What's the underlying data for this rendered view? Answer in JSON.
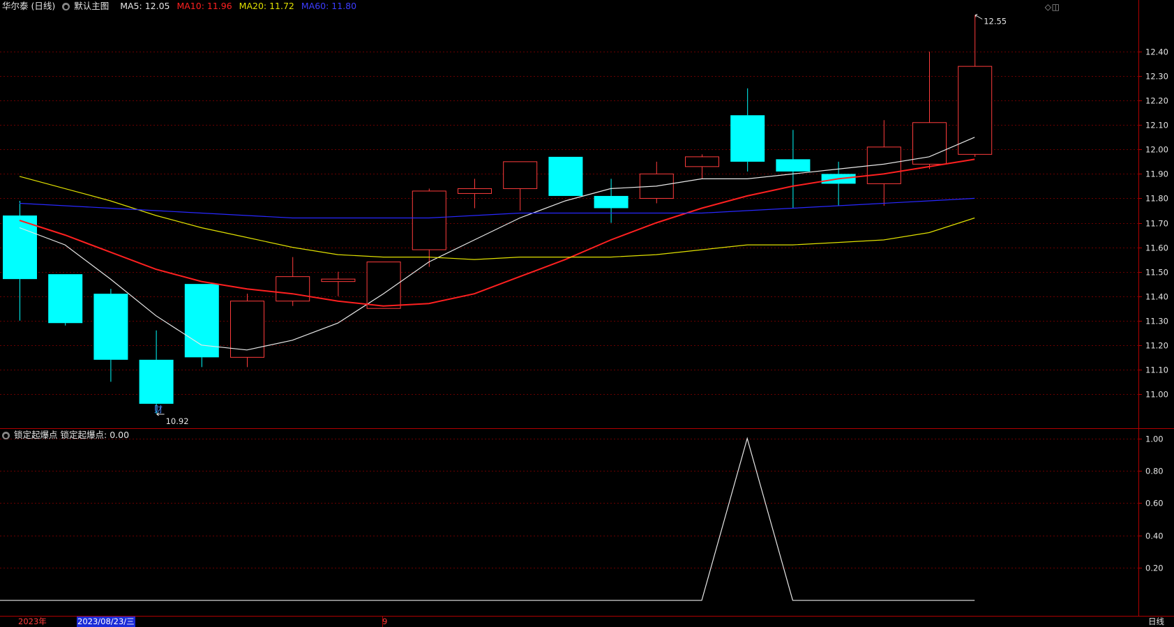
{
  "header": {
    "stock": "华尔泰 (日线)",
    "template": "默认主图",
    "ma5": "MA5: 12.05",
    "ma10": "MA10: 11.96",
    "ma20": "MA20: 11.72",
    "ma60": "MA60: 11.80"
  },
  "indicator": {
    "name": "锁定起爆点",
    "value": "锁定起爆点: 0.00"
  },
  "colors": {
    "up": "#ff3c3c",
    "down": "#00ffff",
    "ma5": "#e8e8e8",
    "ma10": "#ff2020",
    "ma20": "#e0e000",
    "ma60": "#2828ff",
    "axis": "#b00000"
  },
  "annotations": {
    "high": "12.55",
    "low": "10.92",
    "finance_marker": "财"
  },
  "footer": {
    "year": "2023年",
    "date": "2023/08/23/三",
    "month": "9",
    "period": "日线"
  },
  "chart_data": [
    {
      "type": "candlestick",
      "y_ticks": [
        "11.00",
        "11.10",
        "11.20",
        "11.30",
        "11.40",
        "11.50",
        "11.60",
        "11.70",
        "11.80",
        "11.90",
        "12.00",
        "12.10",
        "12.20",
        "12.30",
        "12.40"
      ],
      "ylim": [
        10.86,
        12.56
      ],
      "candles": [
        {
          "o": 11.73,
          "h": 11.79,
          "l": 11.3,
          "c": 11.47
        },
        {
          "o": 11.49,
          "h": 11.49,
          "l": 11.28,
          "c": 11.29
        },
        {
          "o": 11.41,
          "h": 11.43,
          "l": 11.05,
          "c": 11.14
        },
        {
          "o": 11.14,
          "h": 11.26,
          "l": 10.92,
          "c": 10.96
        },
        {
          "o": 11.45,
          "h": 11.45,
          "l": 11.11,
          "c": 11.15
        },
        {
          "o": 11.15,
          "h": 11.41,
          "l": 11.11,
          "c": 11.38
        },
        {
          "o": 11.38,
          "h": 11.56,
          "l": 11.36,
          "c": 11.48
        },
        {
          "o": 11.46,
          "h": 11.5,
          "l": 11.4,
          "c": 11.47
        },
        {
          "o": 11.35,
          "h": 11.54,
          "l": 11.35,
          "c": 11.54
        },
        {
          "o": 11.59,
          "h": 11.84,
          "l": 11.52,
          "c": 11.83
        },
        {
          "o": 11.82,
          "h": 11.88,
          "l": 11.76,
          "c": 11.84
        },
        {
          "o": 11.84,
          "h": 11.95,
          "l": 11.75,
          "c": 11.95
        },
        {
          "o": 11.97,
          "h": 11.97,
          "l": 11.81,
          "c": 11.81
        },
        {
          "o": 11.81,
          "h": 11.88,
          "l": 11.7,
          "c": 11.76
        },
        {
          "o": 11.8,
          "h": 11.95,
          "l": 11.78,
          "c": 11.9
        },
        {
          "o": 11.93,
          "h": 11.98,
          "l": 11.88,
          "c": 11.97
        },
        {
          "o": 12.14,
          "h": 12.25,
          "l": 11.91,
          "c": 11.95
        },
        {
          "o": 11.96,
          "h": 12.08,
          "l": 11.76,
          "c": 11.91
        },
        {
          "o": 11.9,
          "h": 11.95,
          "l": 11.77,
          "c": 11.86
        },
        {
          "o": 11.86,
          "h": 12.12,
          "l": 11.77,
          "c": 12.01
        },
        {
          "o": 11.94,
          "h": 12.4,
          "l": 11.92,
          "c": 12.11
        },
        {
          "o": 11.98,
          "h": 12.55,
          "l": 11.97,
          "c": 12.34
        }
      ],
      "series": [
        {
          "name": "MA5",
          "values": [
            11.68,
            11.61,
            11.47,
            11.32,
            11.2,
            11.18,
            11.22,
            11.29,
            11.41,
            11.54,
            11.63,
            11.72,
            11.79,
            11.84,
            11.85,
            11.88,
            11.88,
            11.9,
            11.92,
            11.94,
            11.97,
            12.05
          ]
        },
        {
          "name": "MA10",
          "values": [
            11.71,
            11.65,
            11.58,
            11.51,
            11.46,
            11.43,
            11.41,
            11.38,
            11.36,
            11.37,
            11.41,
            11.48,
            11.55,
            11.63,
            11.7,
            11.76,
            11.81,
            11.85,
            11.88,
            11.9,
            11.93,
            11.96
          ]
        },
        {
          "name": "MA20",
          "values": [
            11.89,
            11.84,
            11.79,
            11.73,
            11.68,
            11.64,
            11.6,
            11.57,
            11.56,
            11.56,
            11.55,
            11.56,
            11.56,
            11.56,
            11.57,
            11.59,
            11.61,
            11.61,
            11.62,
            11.63,
            11.66,
            11.72
          ]
        },
        {
          "name": "MA60",
          "values": [
            11.78,
            11.77,
            11.76,
            11.75,
            11.74,
            11.73,
            11.72,
            11.72,
            11.72,
            11.72,
            11.73,
            11.74,
            11.74,
            11.74,
            11.74,
            11.74,
            11.75,
            11.76,
            11.77,
            11.78,
            11.79,
            11.8
          ]
        }
      ]
    },
    {
      "type": "line",
      "series": [
        {
          "name": "锁定起爆点",
          "values": [
            0,
            0,
            0,
            0,
            0,
            0,
            0,
            0,
            0,
            0,
            0,
            0,
            0,
            0,
            0,
            0,
            1,
            0,
            0,
            0,
            0,
            0
          ]
        }
      ],
      "y_ticks": [
        "0.20",
        "0.40",
        "0.60",
        "0.80",
        "1.00"
      ],
      "ylim": [
        -0.1,
        1.05
      ],
      "line_x_start": -0.5,
      "line_x_end": 21
    }
  ]
}
